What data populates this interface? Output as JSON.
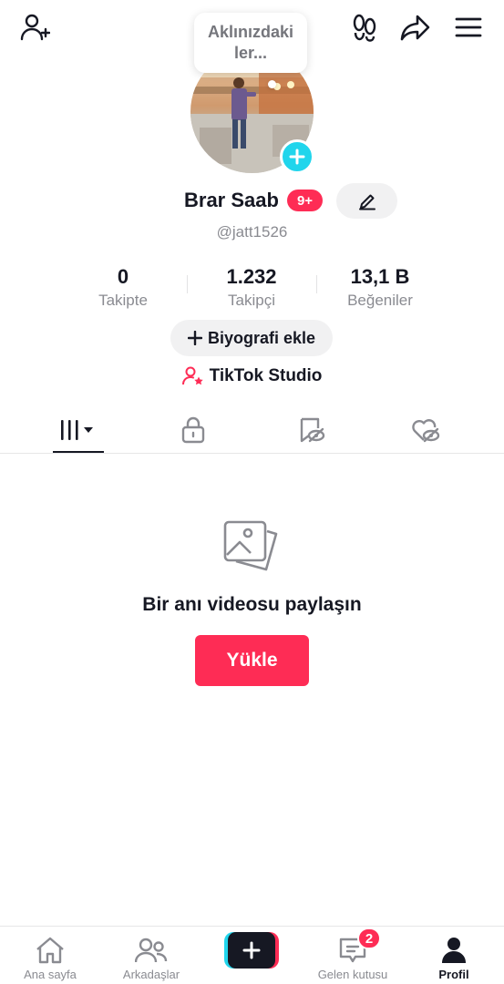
{
  "top_bar": {
    "add_friend_icon": "person-plus-icon",
    "footprints_icon": "footprints-icon",
    "share_icon": "share-arrow-icon",
    "menu_icon": "hamburger-menu-icon"
  },
  "profile": {
    "thought_bubble": "Aklınızdaki ler...",
    "name": "Brar Saab",
    "notification_badge": "9+",
    "handle": "@jatt1526",
    "stats": [
      {
        "value": "0",
        "label": "Takipte"
      },
      {
        "value": "1.232",
        "label": "Takipçi"
      },
      {
        "value": "13,1 B",
        "label": "Beğeniler"
      }
    ],
    "bio_button": "Biyografi ekle",
    "studio_link": "TikTok Studio"
  },
  "tabs": [
    {
      "icon": "videos-grid-icon",
      "active": true
    },
    {
      "icon": "lock-icon",
      "active": false
    },
    {
      "icon": "favorites-hidden-icon",
      "active": false
    },
    {
      "icon": "liked-hidden-icon",
      "active": false
    }
  ],
  "empty_state": {
    "icon": "photos-icon",
    "title": "Bir anı videosu paylaşın",
    "button": "Yükle"
  },
  "bottom_nav": {
    "items": [
      {
        "label": "Ana sayfa",
        "icon": "home-icon"
      },
      {
        "label": "Arkadaşlar",
        "icon": "friends-icon"
      },
      {
        "label": "",
        "icon": "create-plus-icon"
      },
      {
        "label": "Gelen kutusu",
        "icon": "inbox-icon",
        "badge": "2"
      },
      {
        "label": "Profil",
        "icon": "profile-icon",
        "active": true
      }
    ]
  },
  "colors": {
    "accent": "#fe2c55",
    "cyan": "#20d5ec",
    "text": "#161823",
    "muted": "#8a8b91"
  }
}
